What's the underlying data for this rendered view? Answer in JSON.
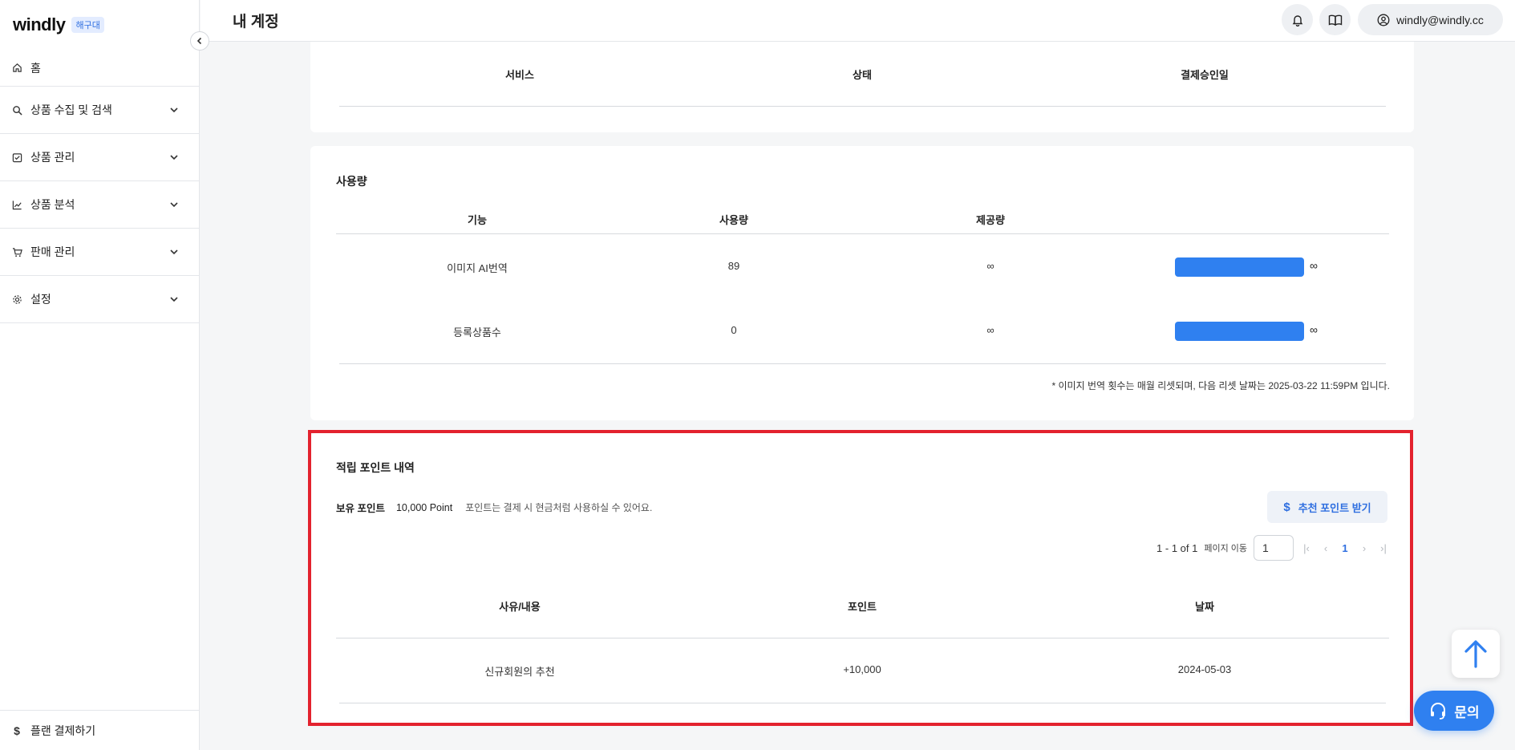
{
  "sidebar": {
    "logo": "windly",
    "badge": "해구대",
    "home": "홈",
    "items": [
      {
        "label": "상품 수집 및 검색",
        "icon": "search-icon"
      },
      {
        "label": "상품 관리",
        "icon": "checklist-icon"
      },
      {
        "label": "상품 분석",
        "icon": "chart-icon"
      },
      {
        "label": "판매 관리",
        "icon": "cart-icon"
      },
      {
        "label": "설정",
        "icon": "gear-icon"
      }
    ],
    "bottom": "플랜 결제하기"
  },
  "header": {
    "title": "내 계정",
    "user_email": "windly@windly.cc"
  },
  "subscription": {
    "columns": [
      "서비스",
      "상태",
      "결제승인일"
    ]
  },
  "usage": {
    "title": "사용량",
    "columns": [
      "기능",
      "사용량",
      "제공량"
    ],
    "rows": [
      {
        "feature": "이미지 AI번역",
        "used": "89",
        "provided": "∞",
        "bar_label": "∞",
        "fill": 1.0
      },
      {
        "feature": "등록상품수",
        "used": "0",
        "provided": "∞",
        "bar_label": "∞",
        "fill": 1.0
      }
    ],
    "note": "* 이미지 번역 횟수는 매월 리셋되며, 다음 리셋 날짜는 2025-03-22 11:59PM 입니다."
  },
  "points": {
    "title": "적립 포인트 내역",
    "holding_label": "보유 포인트",
    "holding_value": "10,000 Point",
    "hint": "포인트는 결제 시 현금처럼 사용하실 수 있어요.",
    "referral_button": "추천 포인트 받기",
    "pager": {
      "range": "1 - 1 of 1",
      "goto_label": "페이지 이동",
      "page_input": "1",
      "current": "1"
    },
    "columns": [
      "사유/내용",
      "포인트",
      "날짜"
    ],
    "rows": [
      {
        "reason": "신규회원의 추천",
        "point": "+10,000",
        "date": "2024-05-03"
      }
    ]
  },
  "floating": {
    "ask": "문의"
  },
  "colors": {
    "accent": "#2f80f0",
    "highlight": "#e3222e"
  }
}
